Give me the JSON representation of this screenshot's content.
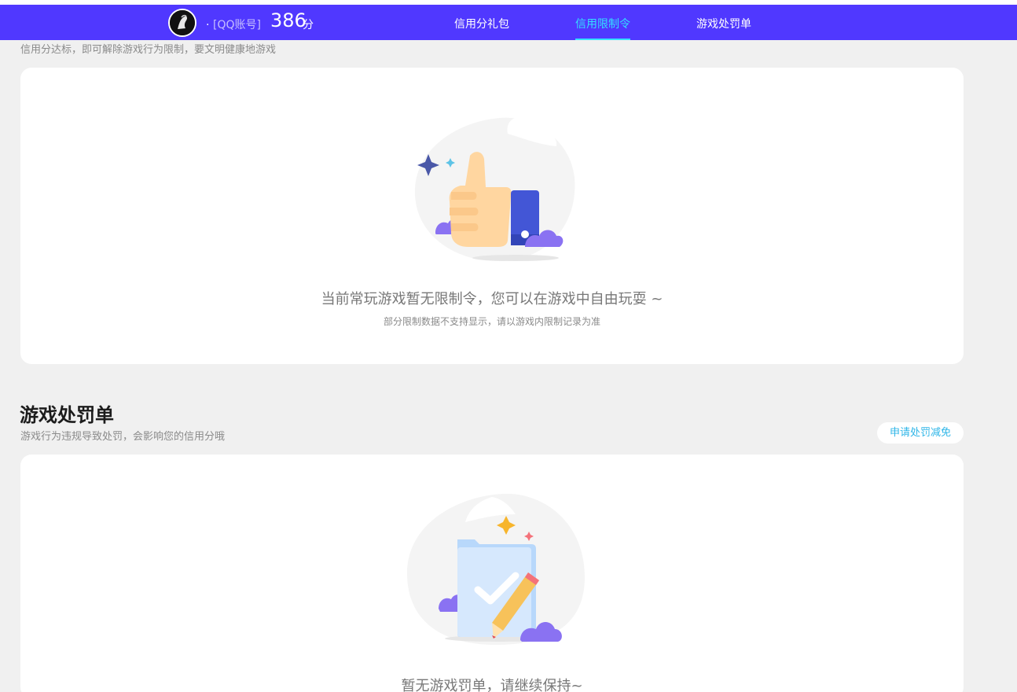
{
  "header": {
    "nickname": ".",
    "account_label": "[QQ账号]",
    "score": "386",
    "score_unit": "分",
    "tabs": [
      {
        "label": "信用分礼包",
        "active": false
      },
      {
        "label": "信用限制令",
        "active": true
      },
      {
        "label": "游戏处罚单",
        "active": false
      }
    ]
  },
  "restriction": {
    "subtitle": "信用分达标，即可解除游戏行为限制，要文明健康地游戏",
    "empty_message": "当前常玩游戏暂无限制令，您可以在游戏中自由玩耍 ~",
    "empty_note": "部分限制数据不支持显示，请以游戏内限制记录为准"
  },
  "penalty": {
    "title": "游戏处罚单",
    "subtitle": "游戏行为违规导致处罚，会影响您的信用分哦",
    "appeal_button": "申请处罚减免",
    "empty_message": "暂无游戏罚单，请继续保持~"
  },
  "colors": {
    "navbar": "#5038ff",
    "active_tab": "#33e0ff",
    "link": "#2fb6e8",
    "background": "#f0f0f0"
  },
  "icons": {
    "restriction_illustration": "thumbs-up-icon",
    "penalty_illustration": "clipboard-pencil-icon"
  }
}
